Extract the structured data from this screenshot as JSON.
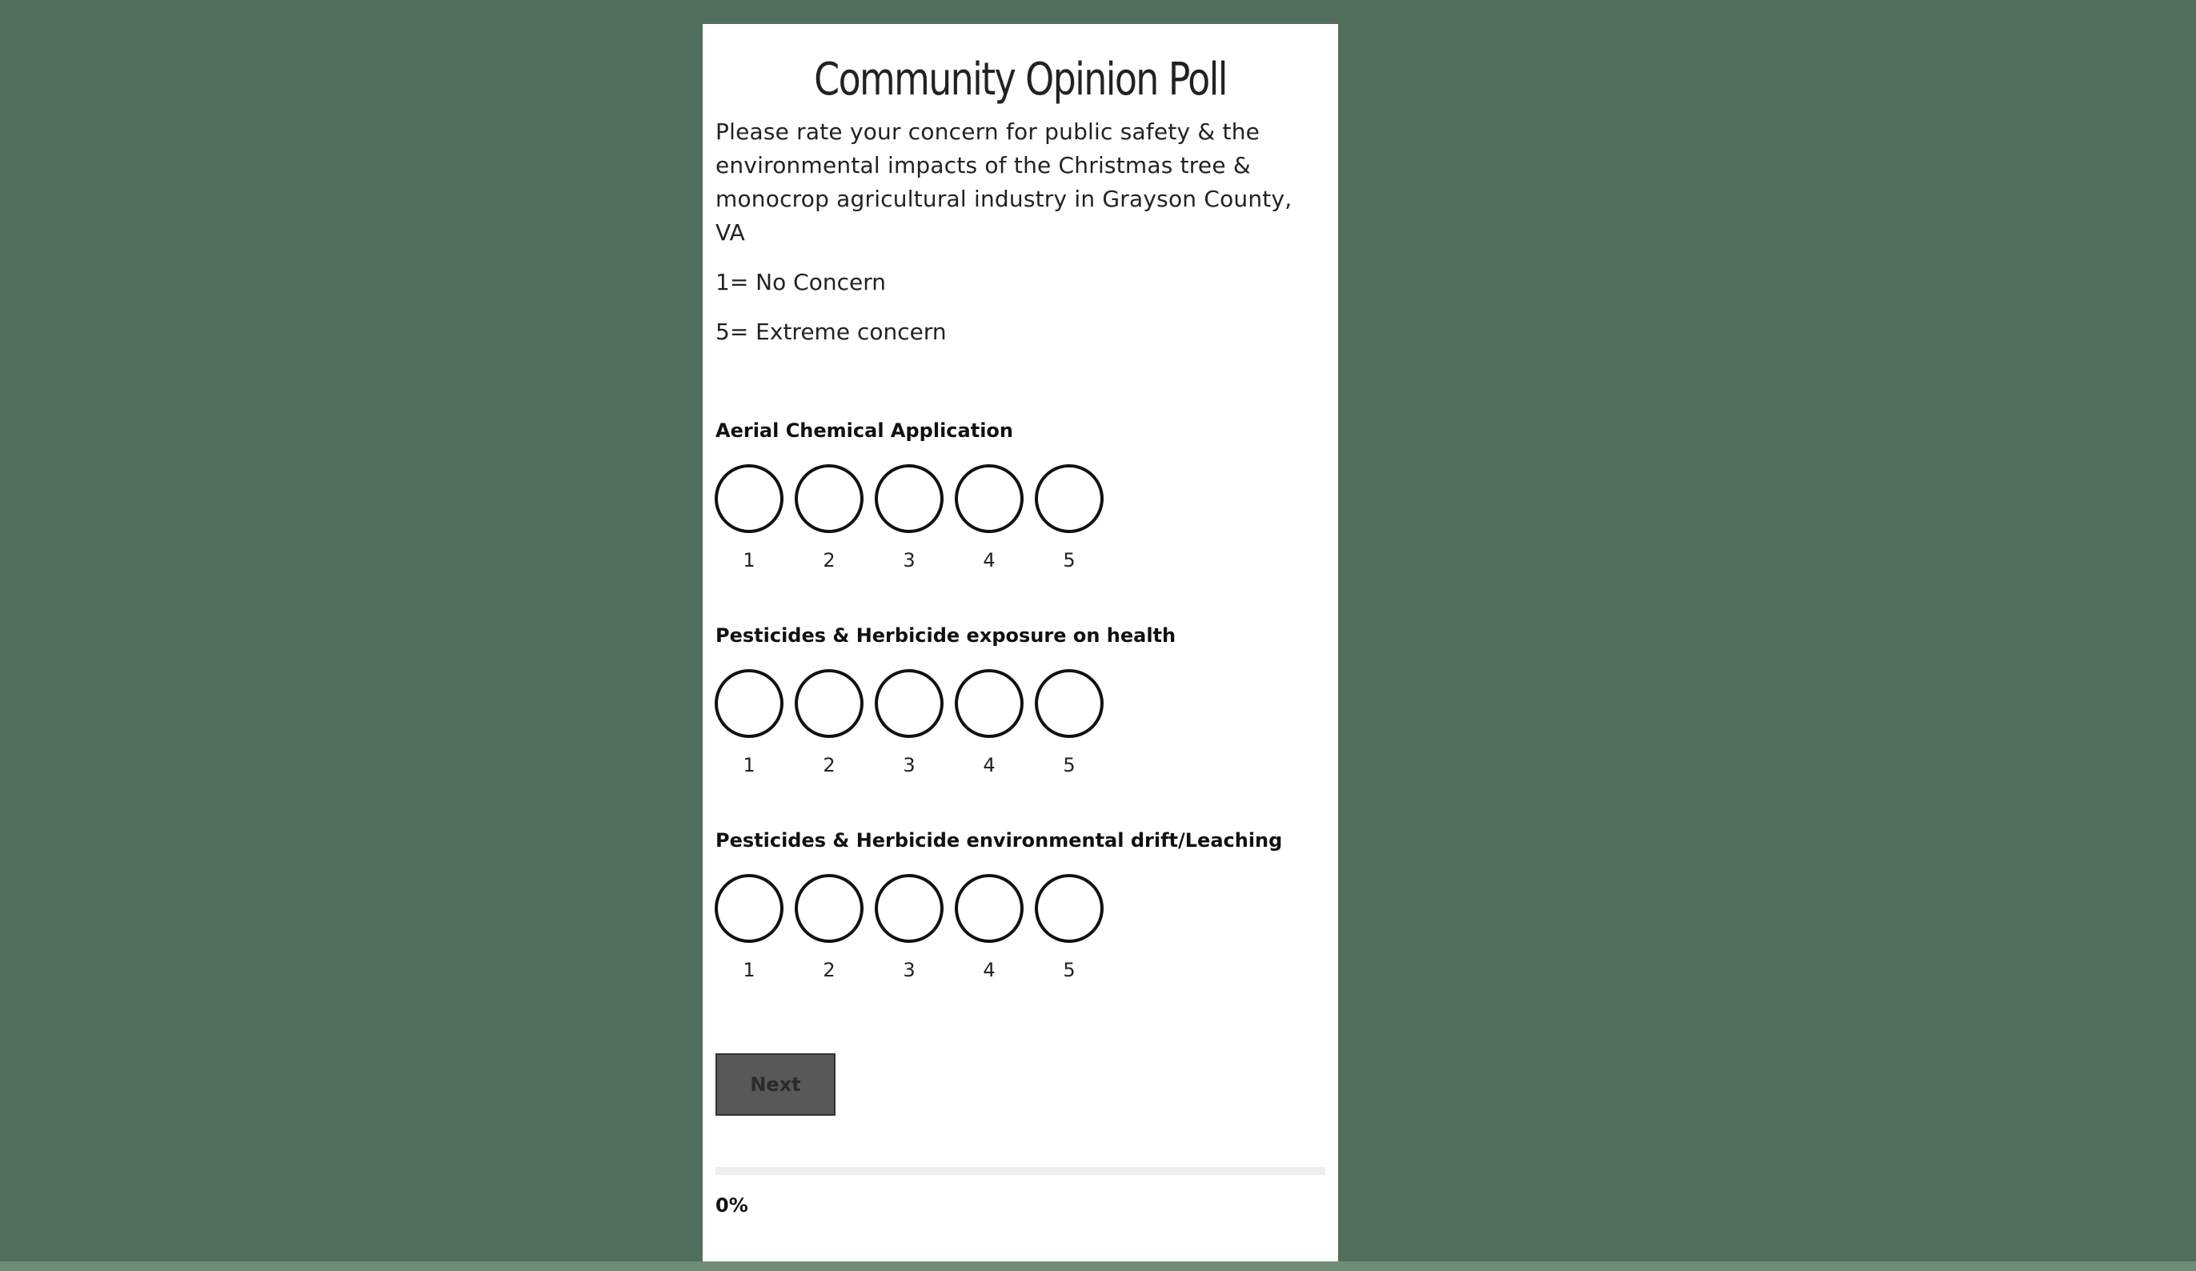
{
  "poll": {
    "title": "Community Opinion Poll",
    "intro": "Please rate your concern for public safety & the environmental impacts of the Christmas tree & monocrop agricultural industry in Grayson County, VA",
    "scale_low": "1= No Concern",
    "scale_high": "5= Extreme concern"
  },
  "questions": [
    {
      "label": "Aerial Chemical Application",
      "options": [
        "1",
        "2",
        "3",
        "4",
        "5"
      ]
    },
    {
      "label": "Pesticides & Herbicide exposure on health",
      "options": [
        "1",
        "2",
        "3",
        "4",
        "5"
      ]
    },
    {
      "label": "Pesticides & Herbicide environmental drift/Leaching",
      "options": [
        "1",
        "2",
        "3",
        "4",
        "5"
      ]
    }
  ],
  "navigation": {
    "next_label": "Next"
  },
  "progress": {
    "value": 0,
    "label": "0%"
  },
  "colors": {
    "page_background": "#526f5d",
    "card_background": "#ffffff",
    "button_background": "#585858"
  }
}
